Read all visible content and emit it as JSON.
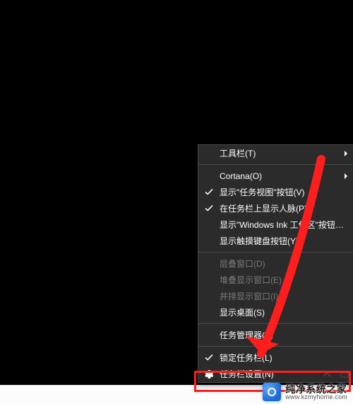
{
  "menu": {
    "toolbars": "工具栏(T)",
    "cortana": "Cortana(O)",
    "taskview": "显示\"任务视图\"按钮(V)",
    "people": "在任务栏上显示人脉(P)",
    "ink": "显示\"Windows Ink 工作区\"按钮(W)",
    "touchkb": "显示触摸键盘按钮(Y)",
    "cascade": "层叠窗口(D)",
    "stacked": "堆叠显示窗口(E)",
    "sidebyside": "并排显示窗口(I)",
    "showdesktop": "显示桌面(S)",
    "taskmgr": "任务管理器(K)",
    "lock": "锁定任务栏(L)",
    "settings": "任务栏设置(N)"
  },
  "watermark": {
    "title": "纯净系统之家",
    "url": "www.kzmyhome.com"
  }
}
